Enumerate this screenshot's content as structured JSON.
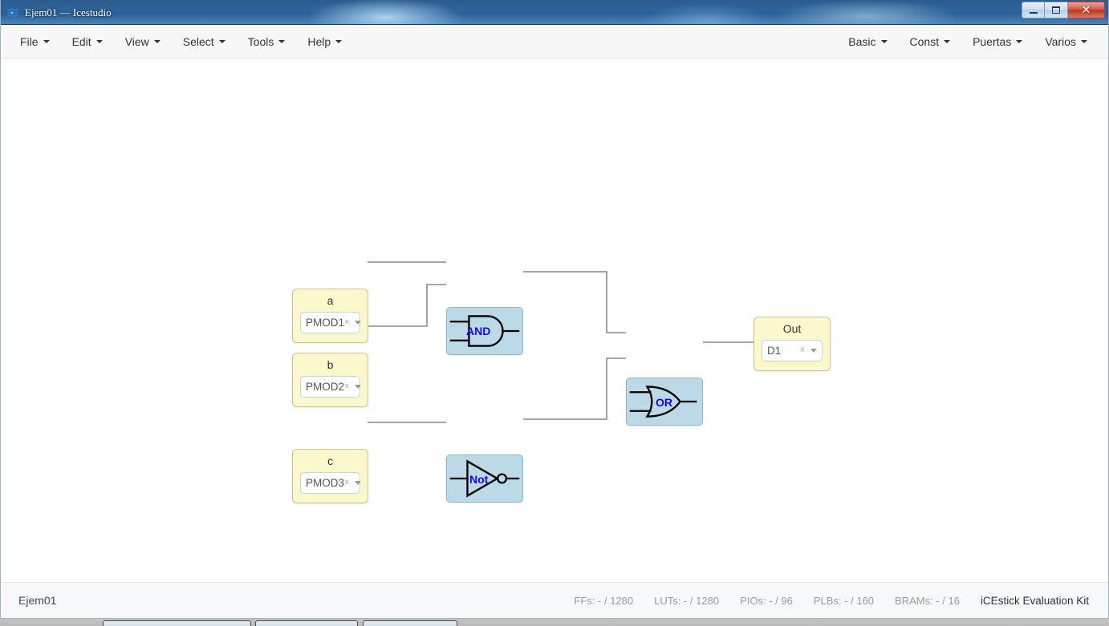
{
  "window": {
    "title": "Ejem01 — Icestudio",
    "app_icon": "icestudio-logo-icon",
    "buttons": {
      "minimize": "minimize-icon",
      "maximize": "maximize-icon",
      "close": "✕"
    }
  },
  "menubar": {
    "left_items": [
      {
        "label": "File"
      },
      {
        "label": "Edit"
      },
      {
        "label": "View"
      },
      {
        "label": "Select"
      },
      {
        "label": "Tools"
      },
      {
        "label": "Help"
      }
    ],
    "right_items": [
      {
        "label": "Basic"
      },
      {
        "label": "Const"
      },
      {
        "label": "Puertas"
      },
      {
        "label": "Varios"
      }
    ]
  },
  "canvas": {
    "blocks": [
      {
        "id": "in-a",
        "kind": "input",
        "label": "a",
        "value": "PMOD1",
        "clear": "×"
      },
      {
        "id": "in-b",
        "kind": "input",
        "label": "b",
        "value": "PMOD2",
        "clear": "×"
      },
      {
        "id": "in-c",
        "kind": "input",
        "label": "c",
        "value": "PMOD3",
        "clear": "×"
      },
      {
        "id": "gate-and",
        "kind": "gate",
        "label": "AND"
      },
      {
        "id": "gate-or",
        "kind": "gate",
        "label": "OR"
      },
      {
        "id": "gate-not",
        "kind": "gate",
        "label": "Not"
      },
      {
        "id": "out-d1",
        "kind": "output",
        "label": "Out",
        "value": "D1",
        "clear": "×"
      }
    ],
    "colors": {
      "io_fill": "#fbf8cd",
      "io_border": "#c8c39a",
      "gate_fill": "#bcd9e8",
      "gate_border": "#8fb6cc",
      "gate_label": "#1500ff",
      "wire": "#888888"
    }
  },
  "statusbar": {
    "project": "Ejem01",
    "stats": [
      {
        "key": "FFs:",
        "value": "- / 1280"
      },
      {
        "key": "LUTs:",
        "value": "- / 1280"
      },
      {
        "key": "PIOs:",
        "value": "- / 96"
      },
      {
        "key": "PLBs:",
        "value": "- / 160"
      },
      {
        "key": "BRAMs:",
        "value": "- / 16"
      }
    ],
    "board": "iCEstick Evaluation Kit"
  }
}
